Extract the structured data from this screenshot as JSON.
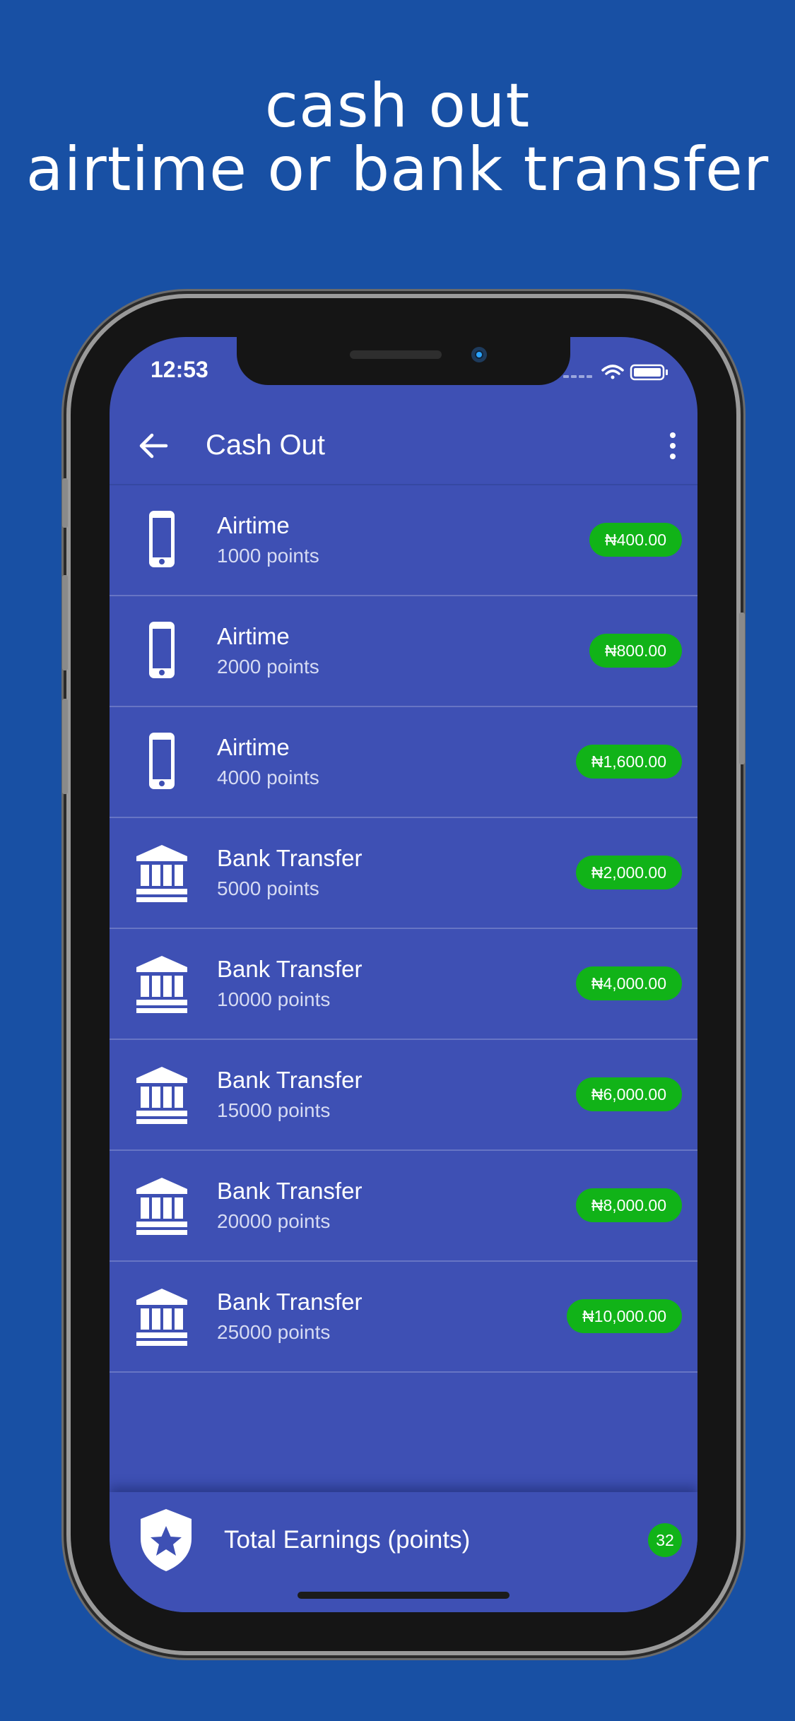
{
  "headline": {
    "line1": "cash out",
    "line2": "airtime or bank transfer"
  },
  "status_bar": {
    "time": "12:53"
  },
  "appbar": {
    "title": "Cash Out",
    "back_icon": "arrow-back-icon",
    "more_icon": "more-vert-icon"
  },
  "items": [
    {
      "title": "Airtime",
      "points": "1000 points",
      "amount": "₦400.00",
      "icon": "phone-icon"
    },
    {
      "title": "Airtime",
      "points": "2000 points",
      "amount": "₦800.00",
      "icon": "phone-icon"
    },
    {
      "title": "Airtime",
      "points": "4000 points",
      "amount": "₦1,600.00",
      "icon": "phone-icon"
    },
    {
      "title": "Bank Transfer",
      "points": "5000 points",
      "amount": "₦2,000.00",
      "icon": "bank-icon"
    },
    {
      "title": "Bank Transfer",
      "points": "10000 points",
      "amount": "₦4,000.00",
      "icon": "bank-icon"
    },
    {
      "title": "Bank Transfer",
      "points": "15000 points",
      "amount": "₦6,000.00",
      "icon": "bank-icon"
    },
    {
      "title": "Bank Transfer",
      "points": "20000 points",
      "amount": "₦8,000.00",
      "icon": "bank-icon"
    },
    {
      "title": "Bank Transfer",
      "points": "25000 points",
      "amount": "₦10,000.00",
      "icon": "bank-icon"
    }
  ],
  "footer": {
    "label": "Total Earnings (points)",
    "value": "32",
    "icon": "shield-star-icon"
  },
  "colors": {
    "background": "#1850a4",
    "screen": "#3e50b4",
    "badge": "#11b318",
    "text": "#ffffff"
  }
}
